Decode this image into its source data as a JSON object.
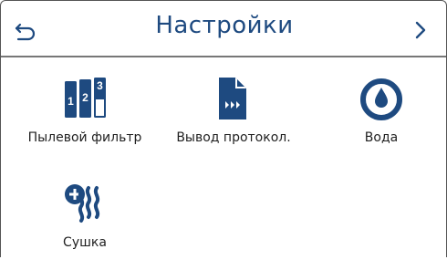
{
  "header": {
    "title": "Настройки",
    "back_icon": "back-arrow-icon",
    "next_icon": "chevron-right-icon"
  },
  "tiles": [
    {
      "label": "Пылевой фильтр",
      "icon": "dust-filter-icon"
    },
    {
      "label": "Вывод протокол.",
      "icon": "protocol-output-icon"
    },
    {
      "label": "Вода",
      "icon": "water-drop-icon"
    },
    {
      "label": "Сушка",
      "icon": "drying-icon"
    }
  ],
  "colors": {
    "accent": "#1e4a80",
    "text": "#1f1f1f"
  }
}
